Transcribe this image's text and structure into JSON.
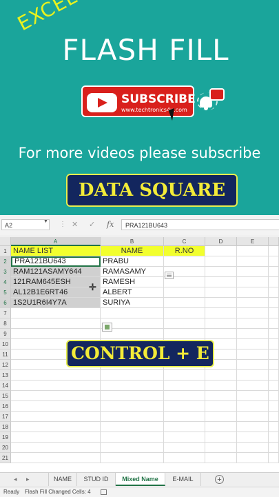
{
  "banner": {
    "excel_tag": "EXCEL",
    "title": "FLASH FILL",
    "subscribe_label": "SUBSCRIBE",
    "subscribe_site": "www.techtronics4u.com",
    "more_videos": "For more  videos please subscribe",
    "brand_badge": "DATA SQUARE",
    "shortcut_badge": "CONTROL + E"
  },
  "colors": {
    "banner_bg": "#1aa59b",
    "badge_bg": "#13265e",
    "badge_text": "#f3eb38",
    "subscribe_red": "#d9201c",
    "header_fill": "#f2ff2e",
    "excel_green": "#217346"
  },
  "formula_bar": {
    "name_box": "A2",
    "cancel_icon": "✕",
    "enter_icon": "✓",
    "fx_label": "fx",
    "content": "PRA121BU643"
  },
  "grid": {
    "columns": [
      "A",
      "B",
      "C",
      "D",
      "E"
    ],
    "rows": [
      "1",
      "2",
      "3",
      "4",
      "5",
      "6",
      "7",
      "8",
      "9",
      "10",
      "11",
      "12",
      "13",
      "14",
      "15",
      "16",
      "17",
      "18",
      "19",
      "20",
      "21"
    ],
    "headers": {
      "a": "NAME LIST",
      "b": "NAME",
      "c": "R.NO"
    },
    "name_list": [
      "PRA121BU643",
      "RAM121ASAMY644",
      "121RAM645ESH",
      "AL12B1E6RT46",
      "1S2U1R6I4Y7A"
    ],
    "names": [
      "PRABU",
      "RAMASAMY",
      "RAMESH",
      "ALBERT",
      "SURIYA"
    ]
  },
  "sheet_tabs": {
    "prev": "◂",
    "next": "▸",
    "items": [
      "NAME",
      "STUD ID",
      "Mixed Name",
      "E-MAIL"
    ],
    "active": "Mixed Name",
    "add": "+"
  },
  "status_bar": {
    "ready": "Ready",
    "message": "Flash Fill Changed Cells: 4"
  }
}
